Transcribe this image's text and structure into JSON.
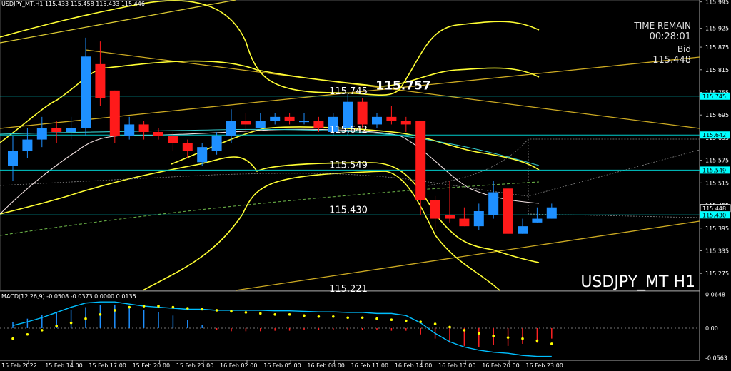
{
  "header": {
    "symbol_info": "USDJPY_MT,H1  115.433 115.458 115.433 115.446"
  },
  "panel": {
    "time_remain_label": "TIME REMAIN",
    "time_remain_value": "00:28:01",
    "bid_label": "Bid",
    "bid_value": "115.448",
    "watermark": "USDJPY_MT H1"
  },
  "levels": [
    {
      "label": "115.745",
      "price": 115.745
    },
    {
      "label": "115.757",
      "price": 115.757
    },
    {
      "label": "115.642",
      "price": 115.642
    },
    {
      "label": "115.549",
      "price": 115.549
    },
    {
      "label": "115.430",
      "price": 115.43
    },
    {
      "label": "115.221",
      "price": 115.221
    }
  ],
  "price_axis": [
    "115.995",
    "115.925",
    "115.875",
    "115.815",
    "115.755",
    "115.695",
    "115.635",
    "115.575",
    "115.515",
    "115.455",
    "115.395",
    "115.335",
    "115.275"
  ],
  "price_tags": [
    {
      "label": "115.745",
      "price": 115.745,
      "color": "#00ffff"
    },
    {
      "label": "115.642",
      "price": 115.642,
      "color": "#00ffff"
    },
    {
      "label": "115.549",
      "price": 115.549,
      "color": "#00ffff"
    },
    {
      "label": "115.448",
      "price": 115.448,
      "color": "#ffffff"
    },
    {
      "label": "115.430",
      "price": 115.43,
      "color": "#00ffff"
    }
  ],
  "time_axis": [
    "15 Feb 2022",
    "15 Feb 14:00",
    "15 Feb 17:00",
    "15 Feb 20:00",
    "15 Feb 23:00",
    "16 Feb 02:00",
    "16 Feb 05:00",
    "16 Feb 08:00",
    "16 Feb 11:00",
    "16 Feb 14:00",
    "16 Feb 17:00",
    "16 Feb 20:00",
    "16 Feb 23:00"
  ],
  "macd": {
    "label": "MACD(12,26,9) -0.0508 -0.0373 0.0000 0.0135",
    "axis": [
      "0.0648",
      "0.00",
      "-0.0563"
    ]
  },
  "colors": {
    "bull": "#1e90ff",
    "bear": "#ff1a1a",
    "level_line": "#00cccc",
    "band": "#ffff33",
    "trend": "#ffcc00",
    "macd_line": "#00bfff",
    "macd_signal": "#ffff00"
  },
  "chart_data": {
    "type": "candlestick",
    "candles": [
      {
        "o": 115.56,
        "h": 115.64,
        "l": 115.52,
        "c": 115.6
      },
      {
        "o": 115.6,
        "h": 115.66,
        "l": 115.58,
        "c": 115.63
      },
      {
        "o": 115.63,
        "h": 115.69,
        "l": 115.61,
        "c": 115.66
      },
      {
        "o": 115.66,
        "h": 115.68,
        "l": 115.62,
        "c": 115.65
      },
      {
        "o": 115.65,
        "h": 115.69,
        "l": 115.63,
        "c": 115.66
      },
      {
        "o": 115.66,
        "h": 115.9,
        "l": 115.64,
        "c": 115.85
      },
      {
        "o": 115.83,
        "h": 115.89,
        "l": 115.72,
        "c": 115.74
      },
      {
        "o": 115.76,
        "h": 115.76,
        "l": 115.62,
        "c": 115.64
      },
      {
        "o": 115.64,
        "h": 115.69,
        "l": 115.63,
        "c": 115.67
      },
      {
        "o": 115.67,
        "h": 115.68,
        "l": 115.63,
        "c": 115.65
      },
      {
        "o": 115.65,
        "h": 115.66,
        "l": 115.63,
        "c": 115.64
      },
      {
        "o": 115.64,
        "h": 115.65,
        "l": 115.6,
        "c": 115.62
      },
      {
        "o": 115.62,
        "h": 115.63,
        "l": 115.58,
        "c": 115.6
      },
      {
        "o": 115.57,
        "h": 115.62,
        "l": 115.56,
        "c": 115.61
      },
      {
        "o": 115.6,
        "h": 115.65,
        "l": 115.59,
        "c": 115.64
      },
      {
        "o": 115.64,
        "h": 115.71,
        "l": 115.62,
        "c": 115.68
      },
      {
        "o": 115.68,
        "h": 115.7,
        "l": 115.65,
        "c": 115.67
      },
      {
        "o": 115.66,
        "h": 115.7,
        "l": 115.66,
        "c": 115.68
      },
      {
        "o": 115.68,
        "h": 115.7,
        "l": 115.67,
        "c": 115.69
      },
      {
        "o": 115.69,
        "h": 115.7,
        "l": 115.67,
        "c": 115.68
      },
      {
        "o": 115.68,
        "h": 115.7,
        "l": 115.67,
        "c": 115.68
      },
      {
        "o": 115.68,
        "h": 115.69,
        "l": 115.65,
        "c": 115.66
      },
      {
        "o": 115.65,
        "h": 115.7,
        "l": 115.64,
        "c": 115.69
      },
      {
        "o": 115.66,
        "h": 115.75,
        "l": 115.64,
        "c": 115.73
      },
      {
        "o": 115.73,
        "h": 115.74,
        "l": 115.66,
        "c": 115.67
      },
      {
        "o": 115.67,
        "h": 115.7,
        "l": 115.66,
        "c": 115.69
      },
      {
        "o": 115.69,
        "h": 115.72,
        "l": 115.67,
        "c": 115.68
      },
      {
        "o": 115.68,
        "h": 115.69,
        "l": 115.65,
        "c": 115.67
      },
      {
        "o": 115.68,
        "h": 115.68,
        "l": 115.43,
        "c": 115.47
      },
      {
        "o": 115.47,
        "h": 115.48,
        "l": 115.39,
        "c": 115.42
      },
      {
        "o": 115.43,
        "h": 115.52,
        "l": 115.41,
        "c": 115.42
      },
      {
        "o": 115.42,
        "h": 115.45,
        "l": 115.4,
        "c": 115.4
      },
      {
        "o": 115.4,
        "h": 115.46,
        "l": 115.39,
        "c": 115.44
      },
      {
        "o": 115.43,
        "h": 115.52,
        "l": 115.42,
        "c": 115.49
      },
      {
        "o": 115.5,
        "h": 115.5,
        "l": 115.38,
        "c": 115.38
      },
      {
        "o": 115.38,
        "h": 115.42,
        "l": 115.38,
        "c": 115.4
      },
      {
        "o": 115.41,
        "h": 115.45,
        "l": 115.41,
        "c": 115.42
      },
      {
        "o": 115.42,
        "h": 115.46,
        "l": 115.42,
        "c": 115.45
      }
    ],
    "macd_hist": [
      0.012,
      0.018,
      0.025,
      0.03,
      0.034,
      0.04,
      0.044,
      0.045,
      0.04,
      0.035,
      0.03,
      0.024,
      0.016,
      0.006,
      -0.004,
      -0.006,
      -0.006,
      -0.006,
      -0.005,
      -0.005,
      -0.004,
      -0.004,
      -0.003,
      -0.003,
      -0.004,
      -0.004,
      -0.005,
      -0.005,
      -0.012,
      -0.02,
      -0.028,
      -0.034,
      -0.036,
      -0.032,
      -0.034,
      -0.03,
      -0.028,
      -0.02
    ],
    "macd_signal": [
      -0.02,
      -0.012,
      -0.004,
      0.004,
      0.01,
      0.018,
      0.026,
      0.034,
      0.04,
      0.042,
      0.042,
      0.04,
      0.038,
      0.036,
      0.034,
      0.032,
      0.03,
      0.028,
      0.026,
      0.026,
      0.024,
      0.022,
      0.022,
      0.02,
      0.02,
      0.018,
      0.016,
      0.014,
      0.012,
      0.008,
      0.002,
      -0.004,
      -0.01,
      -0.015,
      -0.018,
      -0.02,
      -0.024,
      -0.03
    ],
    "macd_line": [
      0.005,
      0.012,
      0.02,
      0.03,
      0.04,
      0.048,
      0.05,
      0.05,
      0.046,
      0.042,
      0.04,
      0.038,
      0.036,
      0.036,
      0.034,
      0.034,
      0.034,
      0.034,
      0.033,
      0.033,
      0.032,
      0.031,
      0.031,
      0.03,
      0.03,
      0.028,
      0.028,
      0.024,
      0.01,
      -0.01,
      -0.026,
      -0.036,
      -0.042,
      -0.046,
      -0.048,
      -0.052,
      -0.054,
      -0.054
    ],
    "ylim": [
      115.23,
      116.0
    ],
    "macd_ylim": [
      -0.06,
      0.068
    ]
  }
}
